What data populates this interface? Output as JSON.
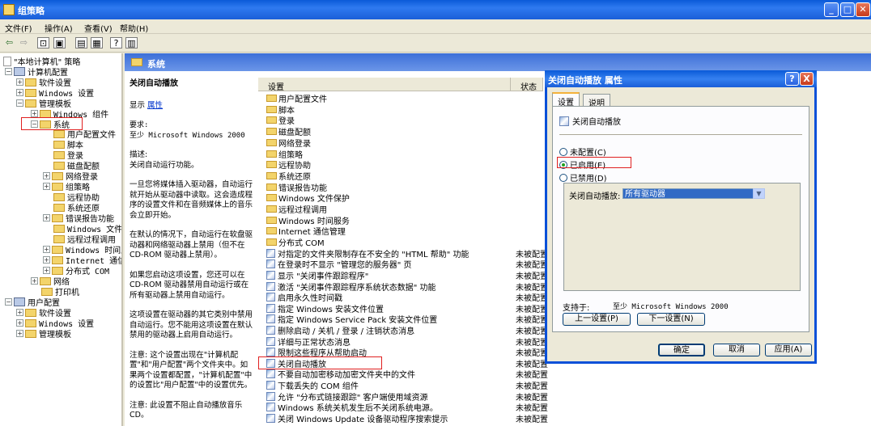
{
  "window": {
    "title": "组策略"
  },
  "menu": [
    "文件(F)",
    "操作(A)",
    "查看(V)",
    "帮助(H)"
  ],
  "tree": {
    "root": "\"本地计算机\" 策略",
    "computer_config": "计算机配置",
    "software_settings": "软件设置",
    "windows_settings": "Windows 设置",
    "admin_templates": "管理模板",
    "windows_components": "Windows 组件",
    "system": "系统",
    "system_children": [
      "用户配置文件",
      "脚本",
      "登录",
      "磁盘配额",
      "网络登录",
      "组策略",
      "远程协助",
      "系统还原",
      "错误报告功能",
      "Windows 文件保",
      "远程过程调用",
      "Windows 时间服",
      "Internet 通信管",
      "分布式 COM"
    ],
    "network": "网络",
    "printers": "打印机",
    "user_config": "用户配置",
    "u_software_settings": "软件设置",
    "u_windows_settings": "Windows 设置",
    "u_admin_templates": "管理模板"
  },
  "pane_header": "系统",
  "description": {
    "title": "关闭自动播放",
    "show_label": "显示",
    "show_link": "属性",
    "requires": "要求:\n至少 Microsoft Windows 2000",
    "desc_label": "描述:\n关闭自动运行功能。",
    "para1": "一旦您将媒体插入驱动器，自动运行就开始从驱动器中读取。这会造成程序的设置文件和在音频媒体上的音乐会立即开始。",
    "para2": "在默认的情况下，自动运行在软盘驱动器和网络驱动器上禁用（但不在 CD-ROM 驱动器上禁用）。",
    "para3": "如果您启动这项设置，您还可以在 CD-ROM 驱动器禁用自动运行或在所有驱动器上禁用自动运行。",
    "para4": "这项设置在驱动器的其它类别中禁用自动运行。您不能用这项设置在默认禁用的驱动器上启用自动运行。",
    "para5": "注意: 这个设置出现在\"计算机配置\"和\"用户配置\"两个文件夹中。如果两个设置都配置，\"计算机配置\"中的设置比\"用户配置\"中的设置优先。",
    "para6": "注意: 此设置不阻止自动播放音乐 CD。"
  },
  "list": {
    "col_setting": "设置",
    "col_state": "状态",
    "folders": [
      "用户配置文件",
      "脚本",
      "登录",
      "磁盘配额",
      "网络登录",
      "组策略",
      "远程协助",
      "系统还原",
      "错误报告功能",
      "Windows 文件保护",
      "远程过程调用",
      "Windows 时间服务",
      "Internet 通信管理",
      "分布式 COM"
    ],
    "settings": [
      {
        "name": "对指定的文件夹限制存在不安全的 \"HTML 帮助\" 功能",
        "state": "未被配置"
      },
      {
        "name": "在登录时不显示 \"管理您的服务器\" 页",
        "state": "未被配置"
      },
      {
        "name": "显示 \"关闭事件跟踪程序\"",
        "state": "未被配置"
      },
      {
        "name": "激活 \"关闭事件跟踪程序系统状态数据\" 功能",
        "state": "未被配置"
      },
      {
        "name": "启用永久性时间戳",
        "state": "未被配置"
      },
      {
        "name": "指定 Windows 安装文件位置",
        "state": "未被配置"
      },
      {
        "name": "指定 Windows Service Pack 安装文件位置",
        "state": "未被配置"
      },
      {
        "name": "删除启动 / 关机 / 登录 / 注销状态消息",
        "state": "未被配置"
      },
      {
        "name": "详细与正常状态消息",
        "state": "未被配置"
      },
      {
        "name": "限制这些程序从帮助启动",
        "state": "未被配置"
      },
      {
        "name": "关闭自动播放",
        "state": "未被配置"
      },
      {
        "name": "不要自动加密移动加密文件夹中的文件",
        "state": "未被配置"
      },
      {
        "name": "下载丢失的 COM 组件",
        "state": "未被配置"
      },
      {
        "name": "允许 \"分布式链接跟踪\" 客户端使用域资源",
        "state": "未被配置"
      },
      {
        "name": "Windows 系统关机发生后不关闭系统电源。",
        "state": "未被配置"
      },
      {
        "name": "关闭 Windows Update 设备驱动程序搜索提示",
        "state": "未被配置"
      }
    ]
  },
  "dialog": {
    "title": "关闭自动播放 属性",
    "help": "?",
    "close": "X",
    "tab_settings": "设置",
    "tab_explain": "说明",
    "setting_name": "关闭自动播放",
    "opt_not_configured": "未配置(C)",
    "opt_enabled": "已启用(E)",
    "opt_disabled": "已禁用(D)",
    "dropdown_label": "关闭自动播放:",
    "dropdown_value": "所有驱动器",
    "supported_label": "支持于:",
    "supported_value": "至少 Microsoft Windows 2000",
    "prev": "上一设置(P)",
    "next": "下一设置(N)",
    "ok": "确定",
    "cancel": "取消",
    "apply": "应用(A)"
  }
}
